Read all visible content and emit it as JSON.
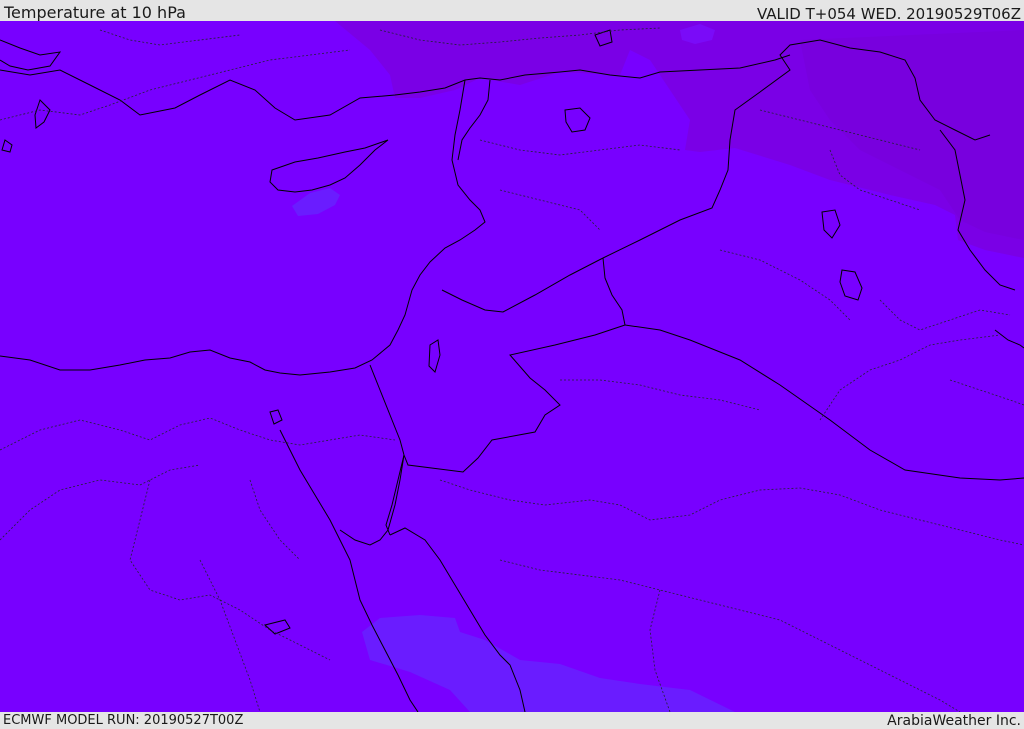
{
  "header": {
    "title": "Temperature at 10 hPa",
    "valid_time": "VALID T+054 WED. 20190529T06Z"
  },
  "footer": {
    "model_run": "ECMWF MODEL RUN: 20190527T00Z",
    "credit": "ArabiaWeather Inc."
  },
  "map": {
    "colors": {
      "base_fill": "#7800ff",
      "cold_region_fill": "#7a00e6",
      "warm_region_fill": "#6a1cff",
      "land_border": "#000000",
      "coast_line": "#000000"
    }
  }
}
